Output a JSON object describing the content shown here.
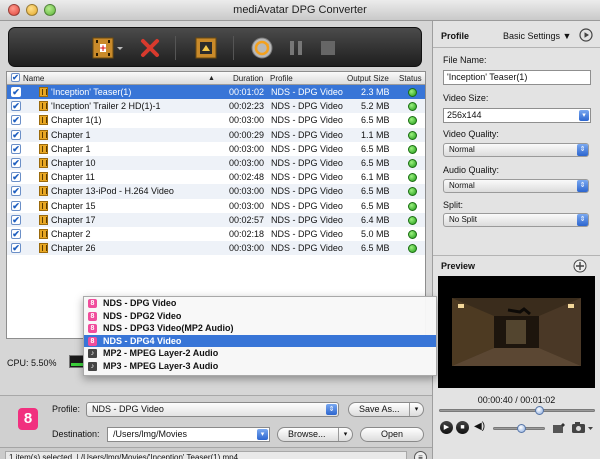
{
  "window": {
    "title": "mediAvatar DPG Converter"
  },
  "table": {
    "headers": {
      "name": "Name",
      "duration": "Duration",
      "profile": "Profile",
      "size": "Output Size",
      "status": "Status"
    },
    "rows": [
      {
        "name": "'Inception' Teaser(1)",
        "duration": "00:01:02",
        "profile": "NDS - DPG Video",
        "size": "2.3 MB",
        "selected": true
      },
      {
        "name": "'Inception' Trailer 2 HD(1)-1",
        "duration": "00:02:23",
        "profile": "NDS - DPG Video",
        "size": "5.2 MB"
      },
      {
        "name": "Chapter 1(1)",
        "duration": "00:03:00",
        "profile": "NDS - DPG Video",
        "size": "6.5 MB"
      },
      {
        "name": "Chapter 1",
        "duration": "00:00:29",
        "profile": "NDS - DPG Video",
        "size": "1.1 MB"
      },
      {
        "name": "Chapter 1",
        "duration": "00:03:00",
        "profile": "NDS - DPG Video",
        "size": "6.5 MB"
      },
      {
        "name": "Chapter 10",
        "duration": "00:03:00",
        "profile": "NDS - DPG Video",
        "size": "6.5 MB"
      },
      {
        "name": "Chapter 11",
        "duration": "00:02:48",
        "profile": "NDS - DPG Video",
        "size": "6.1 MB"
      },
      {
        "name": "Chapter 13-iPod - H.264 Video",
        "duration": "00:03:00",
        "profile": "NDS - DPG Video",
        "size": "6.5 MB"
      },
      {
        "name": "Chapter 15",
        "duration": "00:03:00",
        "profile": "NDS - DPG Video",
        "size": "6.5 MB"
      },
      {
        "name": "Chapter 17",
        "duration": "00:02:57",
        "profile": "NDS - DPG Video",
        "size": "6.4 MB"
      },
      {
        "name": "Chapter 2",
        "duration": "00:02:18",
        "profile": "NDS - DPG Video",
        "size": "5.0 MB"
      },
      {
        "name": "Chapter 26",
        "duration": "00:03:00",
        "profile": "NDS - DPG Video",
        "size": "6.5 MB"
      }
    ]
  },
  "profile_dropdown": {
    "options": [
      {
        "label": "NDS - DPG Video",
        "icon": "nds-icon"
      },
      {
        "label": "NDS - DPG2 Video",
        "icon": "nds-icon"
      },
      {
        "label": "NDS - DPG3 Video(MP2 Audio)",
        "icon": "nds-icon"
      },
      {
        "label": "NDS - DPG4 Video",
        "icon": "nds-icon",
        "selected": true
      },
      {
        "label": "MP2 - MPEG Layer-2 Audio",
        "icon": "audio-icon"
      },
      {
        "label": "MP3 - MPEG Layer-3 Audio",
        "icon": "audio-icon"
      }
    ]
  },
  "cpu": {
    "label": "CPU: 5.50%"
  },
  "bottom": {
    "profile_label": "Profile:",
    "profile_value": "NDS - DPG Video",
    "save_as": "Save As...",
    "destination_label": "Destination:",
    "destination_value": "/Users/lmg/Movies",
    "browse": "Browse...",
    "open": "Open"
  },
  "statusbar": {
    "text": "1 item(s) selected. | /Users/lmg/Movies/'Inception' Teaser(1).mp4"
  },
  "right": {
    "profile_title": "Profile",
    "basic_settings": "Basic Settings",
    "file_name_label": "File Name:",
    "file_name_value": "'Inception' Teaser(1)",
    "video_size_label": "Video Size:",
    "video_size_value": "256x144",
    "video_quality_label": "Video Quality:",
    "video_quality_value": "Normal",
    "audio_quality_label": "Audio Quality:",
    "audio_quality_value": "Normal",
    "split_label": "Split:",
    "split_value": "No Split",
    "preview_title": "Preview",
    "time": "00:00:40 / 00:01:02",
    "progress": 0.645
  },
  "colors": {
    "selection": "#3875d7",
    "status_ok": "#2fbf23",
    "brand_pink": "#f1307f"
  }
}
